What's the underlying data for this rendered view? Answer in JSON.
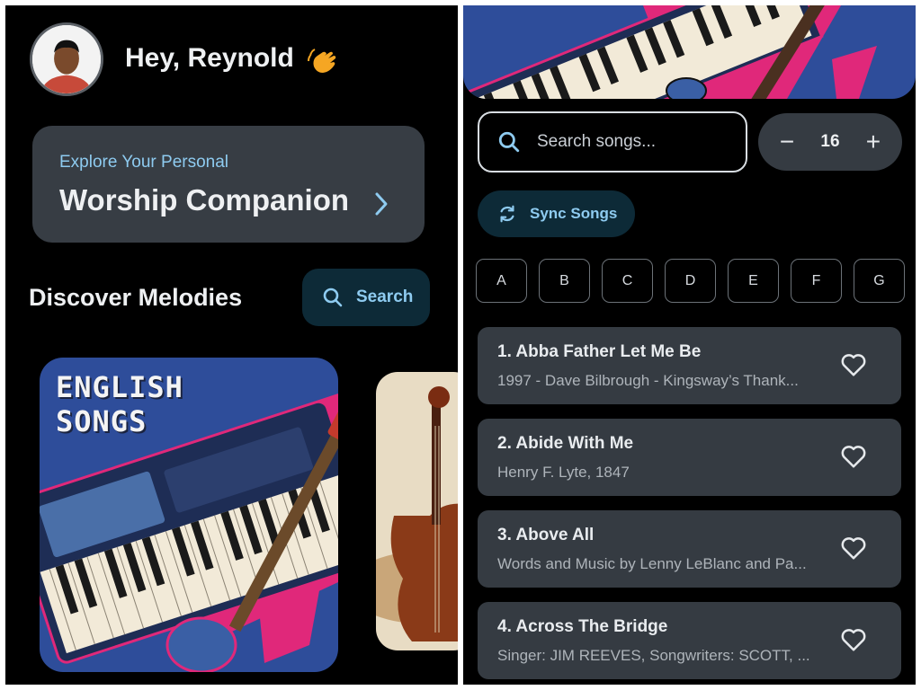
{
  "left": {
    "greeting": "Hey, Reynold",
    "wave_icon": "waving-hand-icon",
    "hero": {
      "subtitle": "Explore Your Personal",
      "title": "Worship Companion"
    },
    "section_title": "Discover Melodies",
    "search_button": "Search",
    "covers": [
      {
        "title_line1": "ENGLISH",
        "title_line2": "SONGS"
      }
    ]
  },
  "right": {
    "search": {
      "placeholder": "Search songs..."
    },
    "font_size": {
      "value": "16",
      "minus": "−",
      "plus": "+"
    },
    "sync_label": "Sync Songs",
    "letters": [
      "A",
      "B",
      "C",
      "D",
      "E",
      "F",
      "G"
    ],
    "songs": [
      {
        "title": "1. Abba Father Let Me Be",
        "subtitle": "1997 - Dave Bilbrough - Kingsway’s Thank..."
      },
      {
        "title": "2. Abide With Me",
        "subtitle": "Henry F. Lyte, 1847"
      },
      {
        "title": "3. Above All",
        "subtitle": "Words and Music by Lenny LeBlanc and Pa..."
      },
      {
        "title": "4. Across The Bridge",
        "subtitle": "Singer: JIM REEVES, Songwriters: SCOTT, ..."
      }
    ]
  },
  "colors": {
    "background": "#000000",
    "card": "#373d44",
    "accent": "#8ecbf0",
    "pill": "#0d2a37",
    "cover_blue": "#2e4d9a",
    "cover_pink": "#e0287a"
  }
}
